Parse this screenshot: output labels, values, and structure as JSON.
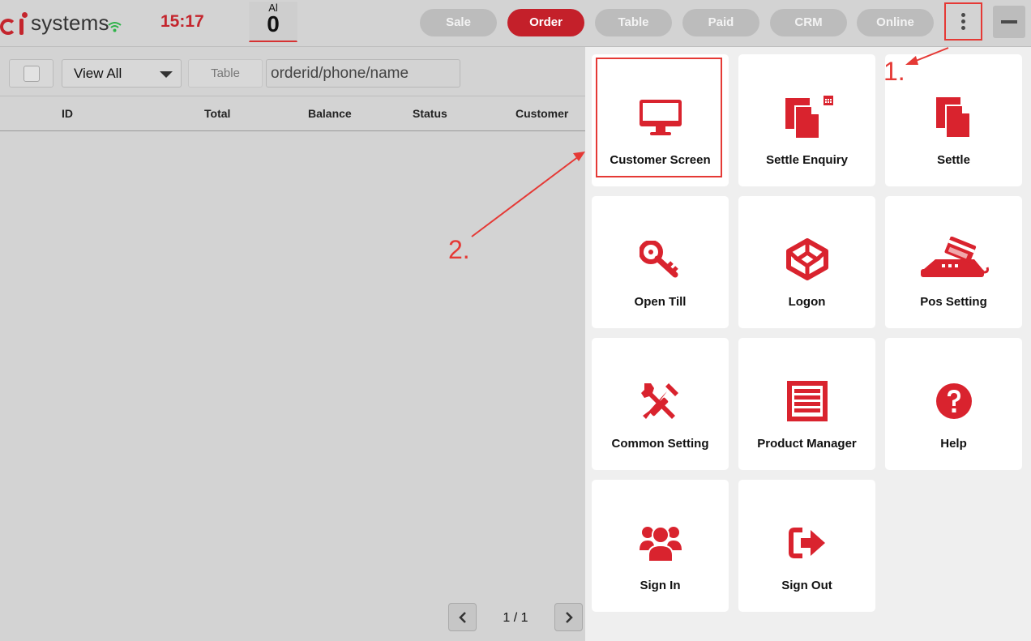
{
  "brand": {
    "name": "systems"
  },
  "header": {
    "time": "15:17",
    "counter_label": "Al",
    "counter_value": "0"
  },
  "nav": [
    {
      "label": "Sale"
    },
    {
      "label": "Order",
      "active": true
    },
    {
      "label": "Table"
    },
    {
      "label": "Paid"
    },
    {
      "label": "CRM"
    },
    {
      "label": "Online"
    }
  ],
  "filters": {
    "view_all": "View All",
    "table_button": "Table",
    "search_placeholder": "orderid/phone/name"
  },
  "table": {
    "columns": [
      "ID",
      "Total",
      "Balance",
      "Status",
      "Customer"
    ]
  },
  "pagination": {
    "text": "1 / 1"
  },
  "menu_tiles": [
    {
      "label": "Customer Screen",
      "icon": "monitor-icon"
    },
    {
      "label": "Settle Enquiry",
      "icon": "documents-calendar-icon"
    },
    {
      "label": "Settle",
      "icon": "documents-icon"
    },
    {
      "label": "Open Till",
      "icon": "key-icon"
    },
    {
      "label": "Logon",
      "icon": "cube-icon"
    },
    {
      "label": "Pos Setting",
      "icon": "card-terminal-icon"
    },
    {
      "label": "Common Setting",
      "icon": "tools-icon"
    },
    {
      "label": "Product Manager",
      "icon": "list-document-icon"
    },
    {
      "label": "Help",
      "icon": "question-circle-icon"
    },
    {
      "label": "Sign In",
      "icon": "users-icon"
    },
    {
      "label": "Sign Out",
      "icon": "sign-out-icon"
    }
  ],
  "annotations": {
    "step1": "1.",
    "step2": "2."
  },
  "colors": {
    "accent": "#e53935",
    "brand": "#c4252d",
    "nav_inactive": "#bcbcbc"
  }
}
